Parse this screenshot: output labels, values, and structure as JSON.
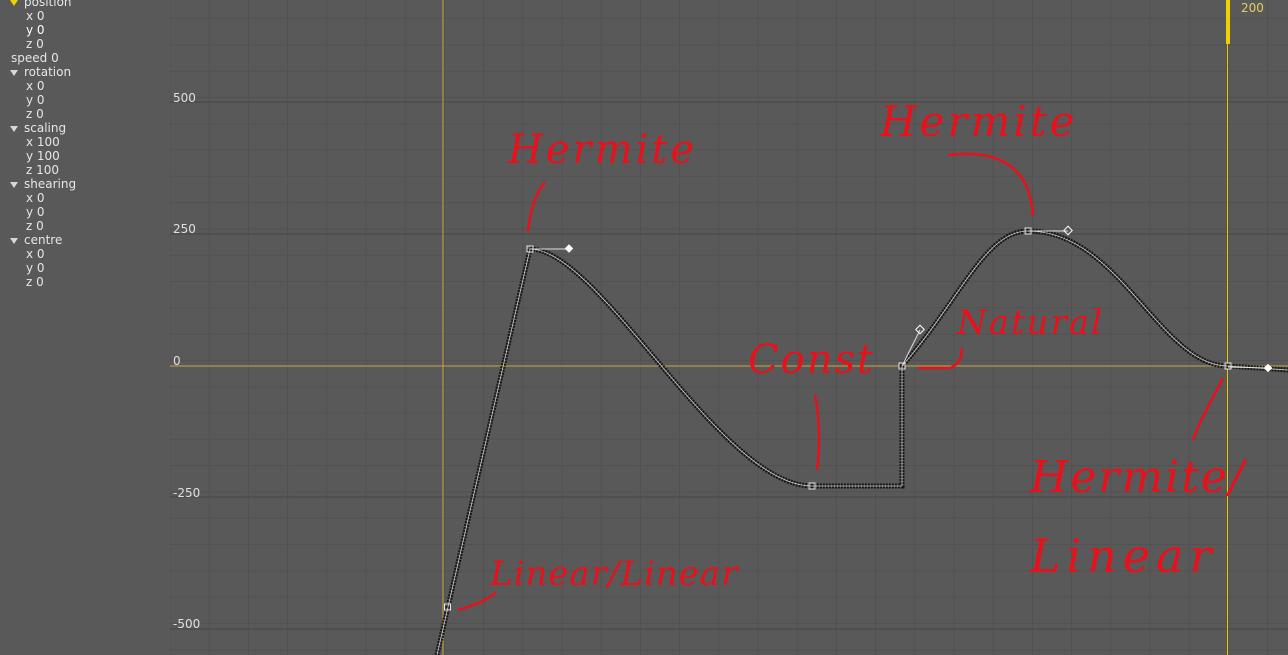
{
  "sidebar": {
    "position": {
      "label": "position",
      "x": "x 0",
      "y": "y 0",
      "z": "z 0"
    },
    "speed": "speed 0",
    "rotation": {
      "label": "rotation",
      "x": "x 0",
      "y": "y 0",
      "z": "z 0"
    },
    "scaling": {
      "label": "scaling",
      "x": "x 100",
      "y": "y 100",
      "z": "z 100"
    },
    "shearing": {
      "label": "shearing",
      "x": "x 0",
      "y": "y 0",
      "z": "z 0"
    },
    "centre": {
      "label": "centre",
      "x": "x 0",
      "y": "y 0",
      "z": "z 0"
    }
  },
  "graph": {
    "current_frame": "200",
    "y_ticks": [
      "500",
      "250",
      "0",
      "-250",
      "-500"
    ]
  },
  "annotations": {
    "a1": "Hermite",
    "a2": "Hermite",
    "a3": "Natural",
    "a4": "Const",
    "a5": "Linear/Linear",
    "a6": "Hermite/",
    "a7": "Linear"
  },
  "colors": {
    "background": "#595959",
    "grid": "#505050",
    "zero_axis": "#c8a83c",
    "playhead": "#f0d000",
    "curve": "#1a1a1a",
    "annotation": "#e8111b"
  }
}
